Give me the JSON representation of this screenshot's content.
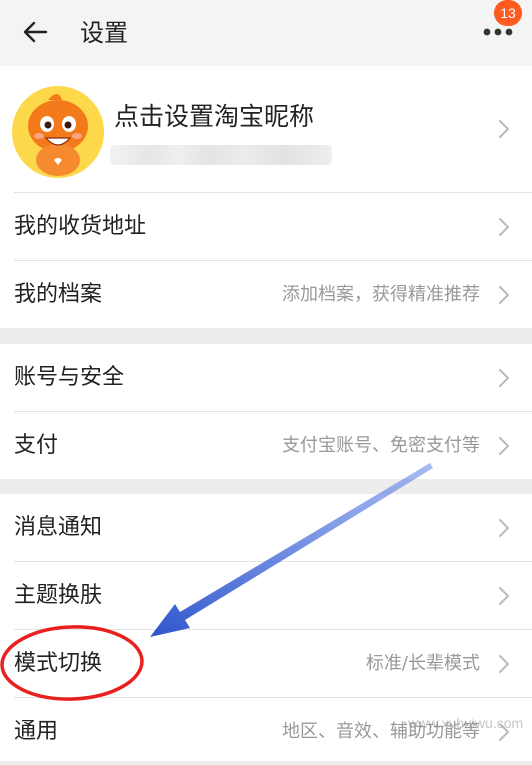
{
  "header": {
    "title": "设置",
    "badge": "13",
    "back_icon": "back-arrow-icon",
    "more_icon": "more-dots-icon"
  },
  "profile": {
    "name": "点击设置淘宝昵称"
  },
  "groups": [
    [
      {
        "label": "我的收货地址",
        "value": ""
      },
      {
        "label": "我的档案",
        "value": "添加档案，获得精准推荐"
      }
    ],
    [
      {
        "label": "账号与安全",
        "value": ""
      },
      {
        "label": "支付",
        "value": "支付宝账号、免密支付等"
      }
    ],
    [
      {
        "label": "消息通知",
        "value": ""
      },
      {
        "label": "主题换肤",
        "value": ""
      },
      {
        "label": "模式切换",
        "value": "标准/长辈模式"
      },
      {
        "label": "通用",
        "value": "地区、音效、辅助功能等"
      }
    ]
  ],
  "watermark": "www.xuhuiwu.com",
  "colors": {
    "badge": "#ff5a1f",
    "annotation_circle": "#e8201e",
    "annotation_arrow": "#3a5fd0",
    "avatar": "#f27a1a"
  }
}
